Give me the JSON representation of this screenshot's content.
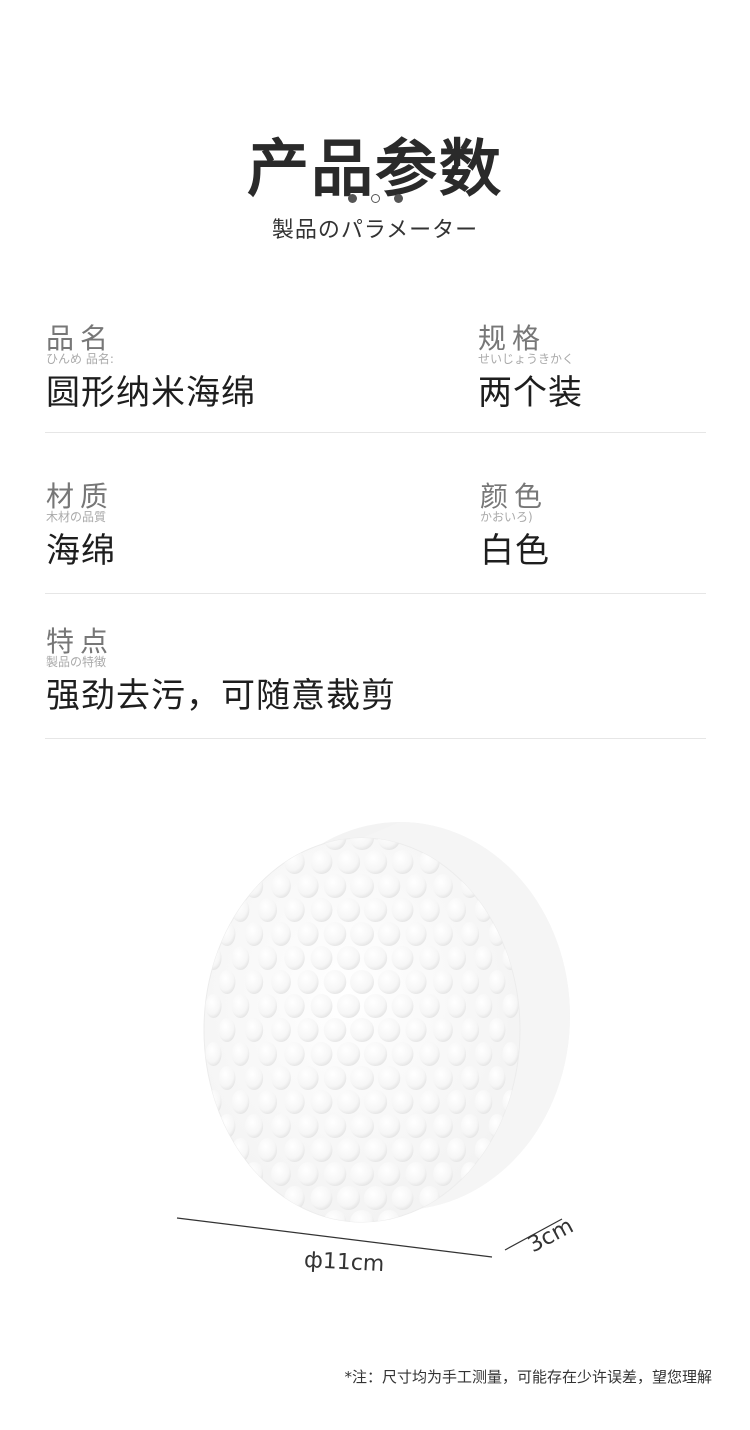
{
  "header": {
    "title": "产品参数",
    "subtitle": "製品のパラメーター"
  },
  "params": [
    {
      "label": "品名",
      "sublabel": "ひんめ 品名:",
      "value": "圆形纳米海绵"
    },
    {
      "label": "规格",
      "sublabel": "せいじょうきかく",
      "value": "两个装"
    },
    {
      "label": "材质",
      "sublabel": "木材の品質",
      "value": "海绵"
    },
    {
      "label": "颜色",
      "sublabel": "かおいろ)",
      "value": "白色"
    },
    {
      "label": "特点",
      "sublabel": "製品の特徴",
      "value": "强劲去污，可随意裁剪"
    }
  ],
  "dimensions": {
    "diameter": "ф11cm",
    "thickness": "3cm"
  },
  "note": "*注：尺寸均为手工测量，可能存在少许误差，望您理解",
  "colors": {
    "text": "#2a2a2a",
    "label": "#777777",
    "divider": "#e6e6e6",
    "sponge": "#ffffff"
  }
}
